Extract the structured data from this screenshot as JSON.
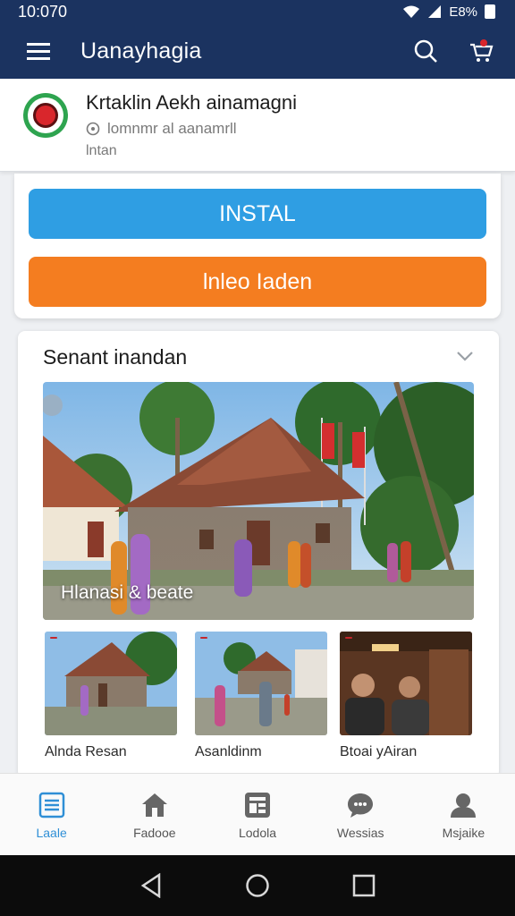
{
  "status_bar": {
    "time": "10:070",
    "battery": "E8%"
  },
  "app_bar": {
    "title": "Uanayhagia"
  },
  "app_info": {
    "name": "Krtaklin Aekh ainamagni",
    "subtitle": "lomnmr al aanamrll",
    "meta": "lntan"
  },
  "actions": {
    "install_label": "INSTAL",
    "secondary_label": "lnleo Iaden"
  },
  "section": {
    "title": "Senant inandan",
    "hero_caption": "Hlanasi & beate",
    "thumbnails": [
      {
        "label": "Alnda Resan"
      },
      {
        "label": "Asanldinm"
      },
      {
        "label": "Btoai yAiran"
      }
    ]
  },
  "bottom_nav": [
    {
      "label": "Laale",
      "icon": "list-icon",
      "active": true
    },
    {
      "label": "Fadooe",
      "icon": "home-icon",
      "active": false
    },
    {
      "label": "Lodola",
      "icon": "apps-icon",
      "active": false
    },
    {
      "label": "Wessias",
      "icon": "chat-icon",
      "active": false
    },
    {
      "label": "Msjaike",
      "icon": "profile-icon",
      "active": false
    }
  ],
  "colors": {
    "primary": "#1b3360",
    "install": "#2f9ee3",
    "secondary": "#f47d20",
    "active_nav": "#2f8fd6"
  }
}
